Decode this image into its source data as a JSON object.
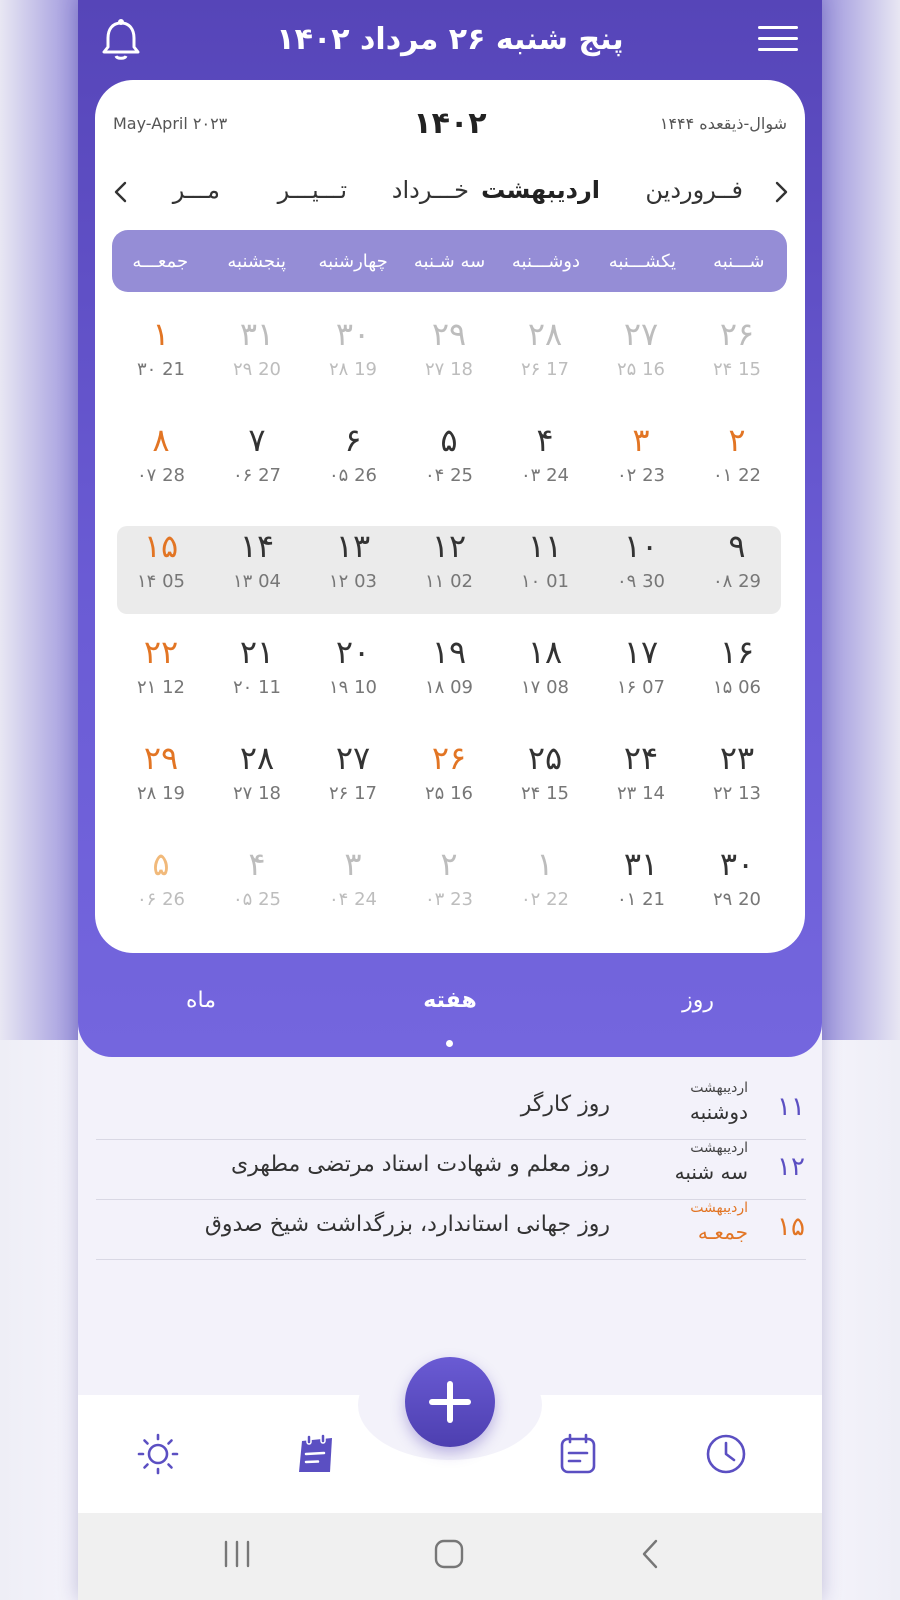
{
  "header": {
    "title": "پنج شنبه ۲۶ مرداد ۱۴۰۲"
  },
  "calendar": {
    "year": "۱۴۰۲",
    "gregorian_range": "May-April ۲۰۲۳",
    "hijri_range": "شوال-ذیقعده ۱۴۴۴",
    "months": [
      {
        "label": "فــروردین"
      },
      {
        "label": "اردیبهشت"
      },
      {
        "label": "خـــرداد"
      },
      {
        "label": "تـــیـــر"
      },
      {
        "label": "مـــر"
      }
    ],
    "active_month_index": 1,
    "weekdays": [
      "شـــنبه",
      "یکشـــنبه",
      "دوشـــنبه",
      "سه شـنبه",
      "چهارشنبه",
      "پنجشنبه",
      "جمعـــه"
    ],
    "weeks": [
      [
        {
          "pd": "۲۶",
          "sub": "۲۴ 15",
          "off": true
        },
        {
          "pd": "۲۷",
          "sub": "۲۵ 16",
          "off": true
        },
        {
          "pd": "۲۸",
          "sub": "۲۶ 17",
          "off": true
        },
        {
          "pd": "۲۹",
          "sub": "۲۷ 18",
          "off": true
        },
        {
          "pd": "۳۰",
          "sub": "۲۸ 19",
          "off": true
        },
        {
          "pd": "۳۱",
          "sub": "۲۹ 20",
          "off": true
        },
        {
          "pd": "۱",
          "sub": "۳۰ 21",
          "hol": true
        }
      ],
      [
        {
          "pd": "۲",
          "sub": "۰۱ 22",
          "hol": true
        },
        {
          "pd": "۳",
          "sub": "۰۲ 23",
          "hol": true
        },
        {
          "pd": "۴",
          "sub": "۰۳ 24"
        },
        {
          "pd": "۵",
          "sub": "۰۴ 25"
        },
        {
          "pd": "۶",
          "sub": "۰۵ 26"
        },
        {
          "pd": "۷",
          "sub": "۰۶ 27"
        },
        {
          "pd": "۸",
          "sub": "۰۷ 28",
          "hol": true
        }
      ],
      [
        {
          "pd": "۹",
          "sub": "۰۸ 29"
        },
        {
          "pd": "۱۰",
          "sub": "۰۹ 30"
        },
        {
          "pd": "۱۱",
          "sub": "۱۰ 01"
        },
        {
          "pd": "۱۲",
          "sub": "۱۱ 02"
        },
        {
          "pd": "۱۳",
          "sub": "۱۲ 03"
        },
        {
          "pd": "۱۴",
          "sub": "۱۳ 04"
        },
        {
          "pd": "۱۵",
          "sub": "۱۴ 05",
          "hol": true
        }
      ],
      [
        {
          "pd": "۱۶",
          "sub": "۱۵ 06"
        },
        {
          "pd": "۱۷",
          "sub": "۱۶ 07"
        },
        {
          "pd": "۱۸",
          "sub": "۱۷ 08"
        },
        {
          "pd": "۱۹",
          "sub": "۱۸ 09"
        },
        {
          "pd": "۲۰",
          "sub": "۱۹ 10"
        },
        {
          "pd": "۲۱",
          "sub": "۲۰ 11"
        },
        {
          "pd": "۲۲",
          "sub": "۲۱ 12",
          "hol": true
        }
      ],
      [
        {
          "pd": "۲۳",
          "sub": "۲۲ 13"
        },
        {
          "pd": "۲۴",
          "sub": "۲۳ 14"
        },
        {
          "pd": "۲۵",
          "sub": "۲۴ 15"
        },
        {
          "pd": "۲۶",
          "sub": "۲۵ 16",
          "hol": true
        },
        {
          "pd": "۲۷",
          "sub": "۲۶ 17"
        },
        {
          "pd": "۲۸",
          "sub": "۲۷ 18"
        },
        {
          "pd": "۲۹",
          "sub": "۲۸ 19",
          "hol": true
        }
      ],
      [
        {
          "pd": "۳۰",
          "sub": "۲۹ 20"
        },
        {
          "pd": "۳۱",
          "sub": "۰۱ 21"
        },
        {
          "pd": "۱",
          "sub": "۰۲ 22",
          "off": true
        },
        {
          "pd": "۲",
          "sub": "۰۳ 23",
          "off": true
        },
        {
          "pd": "۳",
          "sub": "۰۴ 24",
          "off": true
        },
        {
          "pd": "۴",
          "sub": "۰۵ 25",
          "off": true
        },
        {
          "pd": "۵",
          "sub": "۰۶ 26",
          "off": true,
          "hol": true
        }
      ]
    ],
    "selected_week_index": 2
  },
  "views": {
    "day": "روز",
    "week": "هفته",
    "month": "ماه"
  },
  "events": [
    {
      "num": "۱۱",
      "month": "اردیبهشت",
      "weekday": "دوشنبه",
      "text": "روز کارگر",
      "hol": false
    },
    {
      "num": "۱۲",
      "month": "اردیبهشت",
      "weekday": "سه شنبه",
      "text": "روز معلم و شهادت استاد مرتضی مطهری",
      "hol": false
    },
    {
      "num": "۱۵",
      "month": "اردیبهشت",
      "weekday": "جمعـه",
      "text": "روز جهانی استاندارد، بزرگداشت شیخ صدوق",
      "hol": true
    }
  ],
  "bottom_nav": [
    "sun-icon",
    "calendar-notes-icon",
    "add-icon",
    "calendar-list-icon",
    "clock-icon"
  ],
  "colors": {
    "primary": "#5b4fc2",
    "holiday": "#e27524",
    "week_bar": "#958dd6"
  }
}
